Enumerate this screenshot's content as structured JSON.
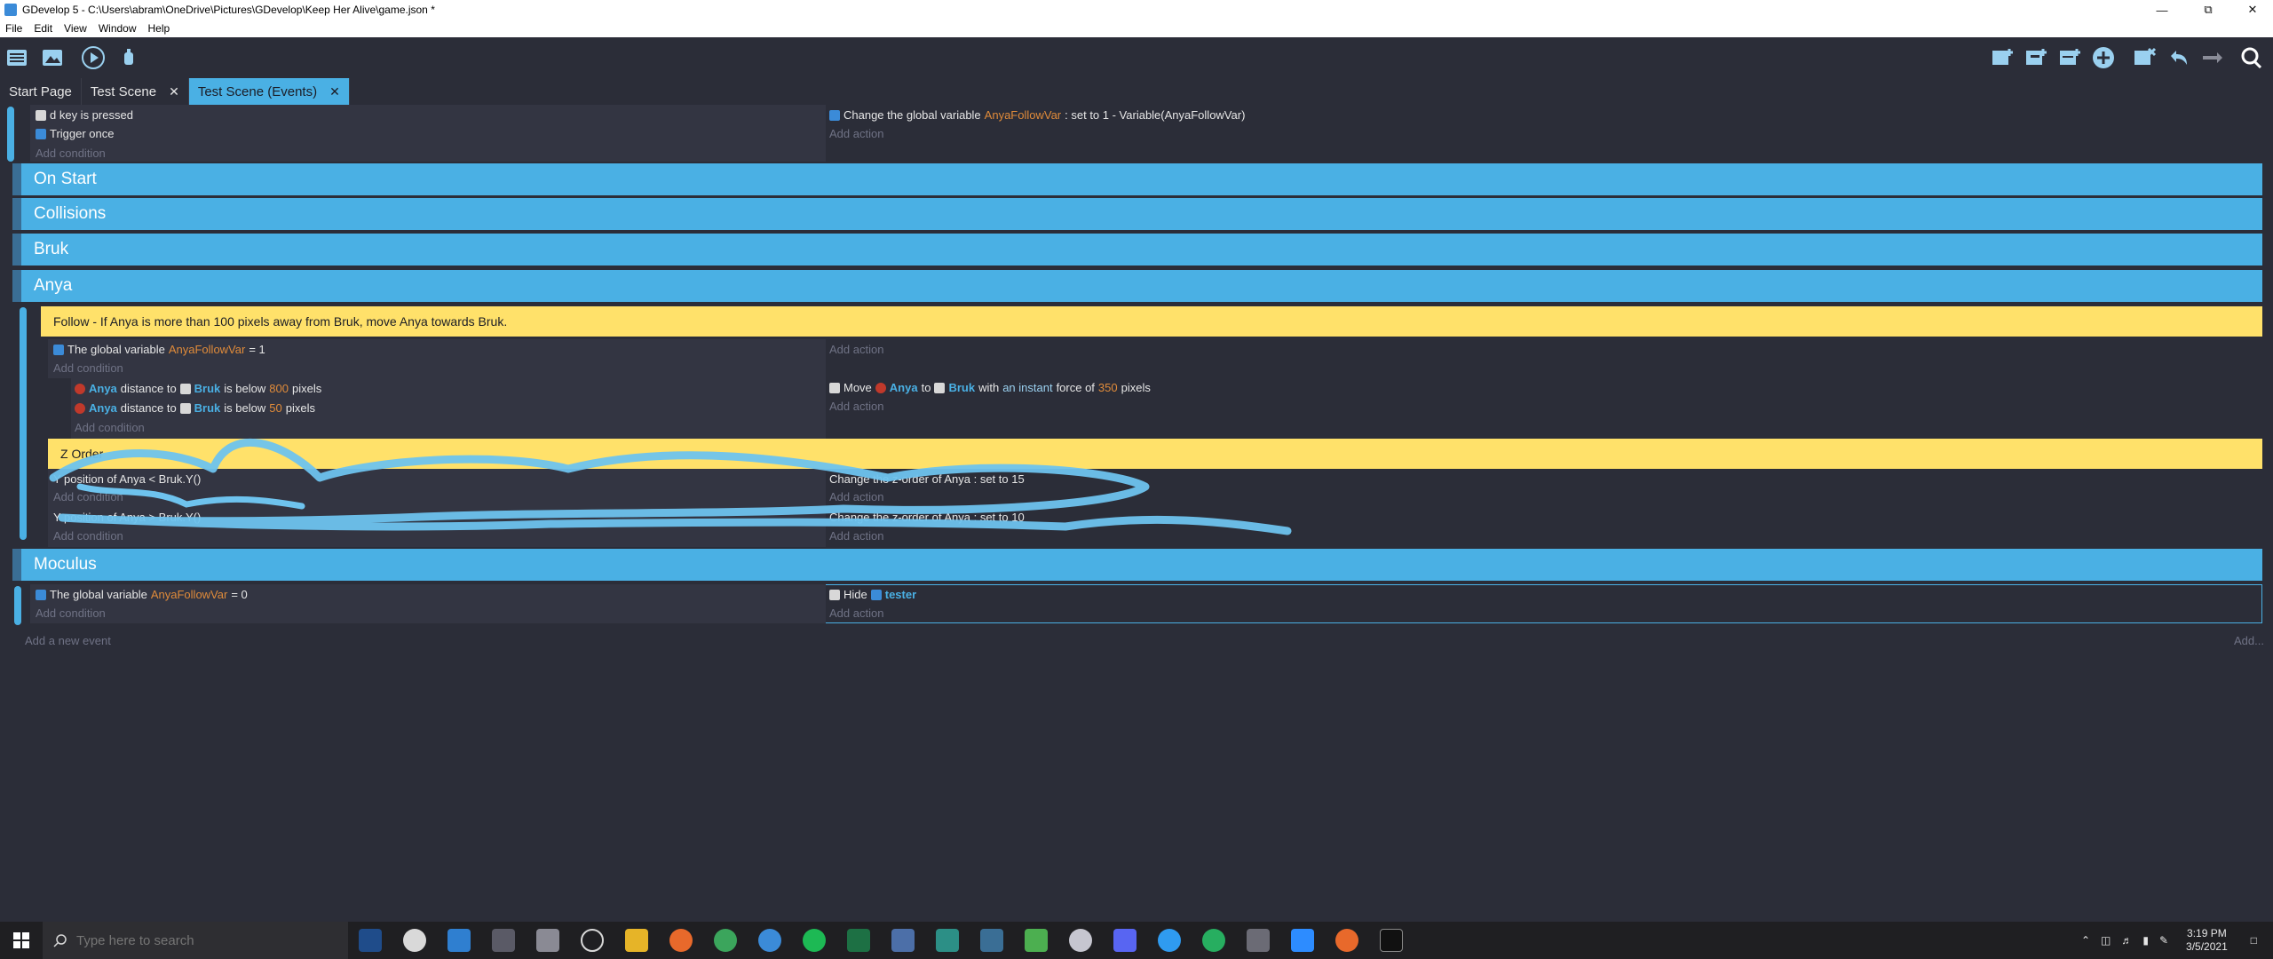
{
  "window": {
    "title": "GDevelop 5 - C:\\Users\\abram\\OneDrive\\Pictures\\GDevelop\\Keep Her Alive\\game.json *"
  },
  "menu": {
    "items": [
      "File",
      "Edit",
      "View",
      "Window",
      "Help"
    ]
  },
  "tabs": [
    {
      "label": "Start Page",
      "closable": false,
      "active": false
    },
    {
      "label": "Test Scene",
      "closable": true,
      "active": false
    },
    {
      "label": "Test Scene (Events)",
      "closable": true,
      "active": true
    }
  ],
  "events": {
    "event1": {
      "conditions": [
        "d key is pressed",
        "Trigger once"
      ],
      "add_condition": "Add condition",
      "action": {
        "prefix": "Change the global variable",
        "var": "AnyaFollowVar",
        "suffix": ": set to  1 - Variable(AnyaFollowVar)"
      },
      "add_action": "Add action"
    },
    "groups": {
      "on_start": "On Start",
      "collisions": "Collisions",
      "bruk": "Bruk",
      "anya": "Anya",
      "moculus": "Moculus"
    },
    "follow_comment": "Follow - If Anya is more than 100 pixels away from Bruk, move Anya towards Bruk.",
    "follow_event": {
      "cond_prefix": "The global variable",
      "cond_var": "AnyaFollowVar",
      "cond_suffix": " = 1",
      "add_condition": "Add condition",
      "add_action": "Add action"
    },
    "sub_event": {
      "cond1": {
        "obj": "Anya",
        "mid": "distance to",
        "target": "Bruk",
        "rel": "is below",
        "num": "800",
        "unit": "pixels"
      },
      "cond2": {
        "obj": "Anya",
        "mid": "distance to",
        "target": "Bruk",
        "rel": "is below",
        "num": "50",
        "unit": "pixels"
      },
      "add_condition": "Add condition",
      "action": {
        "verb": "Move",
        "obj": "Anya",
        "to": "to",
        "target": "Bruk",
        "with": "with",
        "force_type": "an instant",
        "force_word": "force of",
        "num": "350",
        "unit": "pixels"
      },
      "add_action": "Add action"
    },
    "zorder_comment": "Z   Order",
    "zorder_event1": {
      "cond": "Y position of  Anya  < Bruk.Y()",
      "add_condition": "Add condition",
      "action": "Change the z-order of  Anya : set to  15",
      "add_action": "Add action"
    },
    "zorder_event2": {
      "cond": "Y position of  Anya  > Bruk.Y()",
      "add_condition": "Add condition",
      "action": "Change the z-order of  Anya : set to  10",
      "add_action": "Add action"
    },
    "moculus_event": {
      "cond_prefix": "The global variable",
      "cond_var": "AnyaFollowVar",
      "cond_suffix": " = 0",
      "add_condition": "Add condition",
      "action_verb": "Hide",
      "action_obj": "tester",
      "add_action": "Add action"
    },
    "add_event": "Add a new event",
    "add_more": "Add..."
  },
  "taskbar": {
    "search_placeholder": "Type here to search",
    "time": "3:19 PM",
    "date": "3/5/2021"
  },
  "colors": {
    "accent": "#4ab0e4",
    "comment": "#ffe16a",
    "background": "#2b2d38"
  }
}
